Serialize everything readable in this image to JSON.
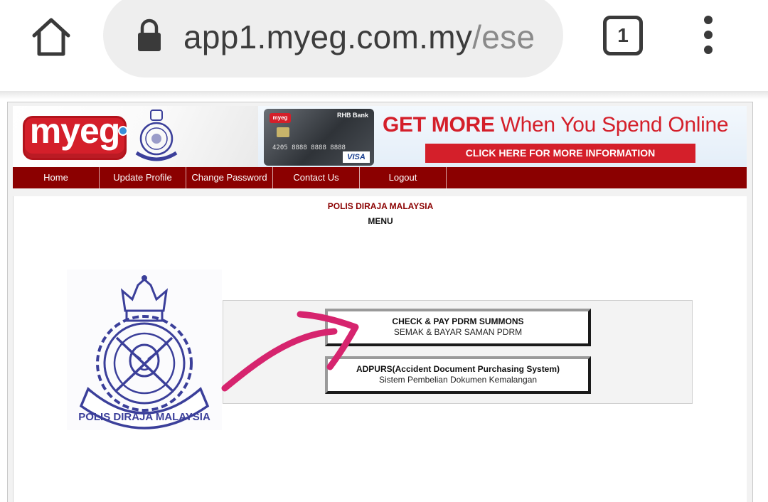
{
  "browser": {
    "url_host": "app1.myeg.com.my",
    "url_path": "/ese",
    "tab_count": "1",
    "icons": {
      "home": "home-icon",
      "lock": "lock-icon",
      "tabs": "tabs-counter-icon",
      "menu": "more-vert-icon"
    }
  },
  "banner": {
    "logo_text": "myeg",
    "crest_icon": "pdrm-crest-icon",
    "ad": {
      "card_bank": "RHB Bank",
      "card_number": "4205 8888 8888 8888",
      "card_brand": "VISA",
      "card_mini_logo": "myeg",
      "headline_bold": "GET MORE",
      "headline_rest": " When You Spend Online",
      "cta": "CLICK HERE FOR MORE INFORMATION"
    }
  },
  "nav": {
    "items": [
      {
        "label": "Home"
      },
      {
        "label": "Update Profile"
      },
      {
        "label": "Change Password"
      },
      {
        "label": "Contact Us"
      },
      {
        "label": "Logout"
      }
    ]
  },
  "main": {
    "agency": "POLIS DIRAJA MALAYSIA",
    "menu_title": "MENU",
    "crest_text": "POLIS DIRAJA MALAYSIA",
    "options": [
      {
        "title": "CHECK & PAY PDRM SUMMONS",
        "subtitle": "SEMAK & BAYAR SAMAN PDRM"
      },
      {
        "title": "ADPURS(Accident Document Purchasing System)",
        "subtitle": "Sistem Pembelian Dokumen Kemalangan"
      }
    ]
  },
  "colors": {
    "brand_red": "#d41f2a",
    "nav_maroon": "#8b0000",
    "crest_blue": "#3b3f9a",
    "annotation_pink": "#d6246e"
  }
}
